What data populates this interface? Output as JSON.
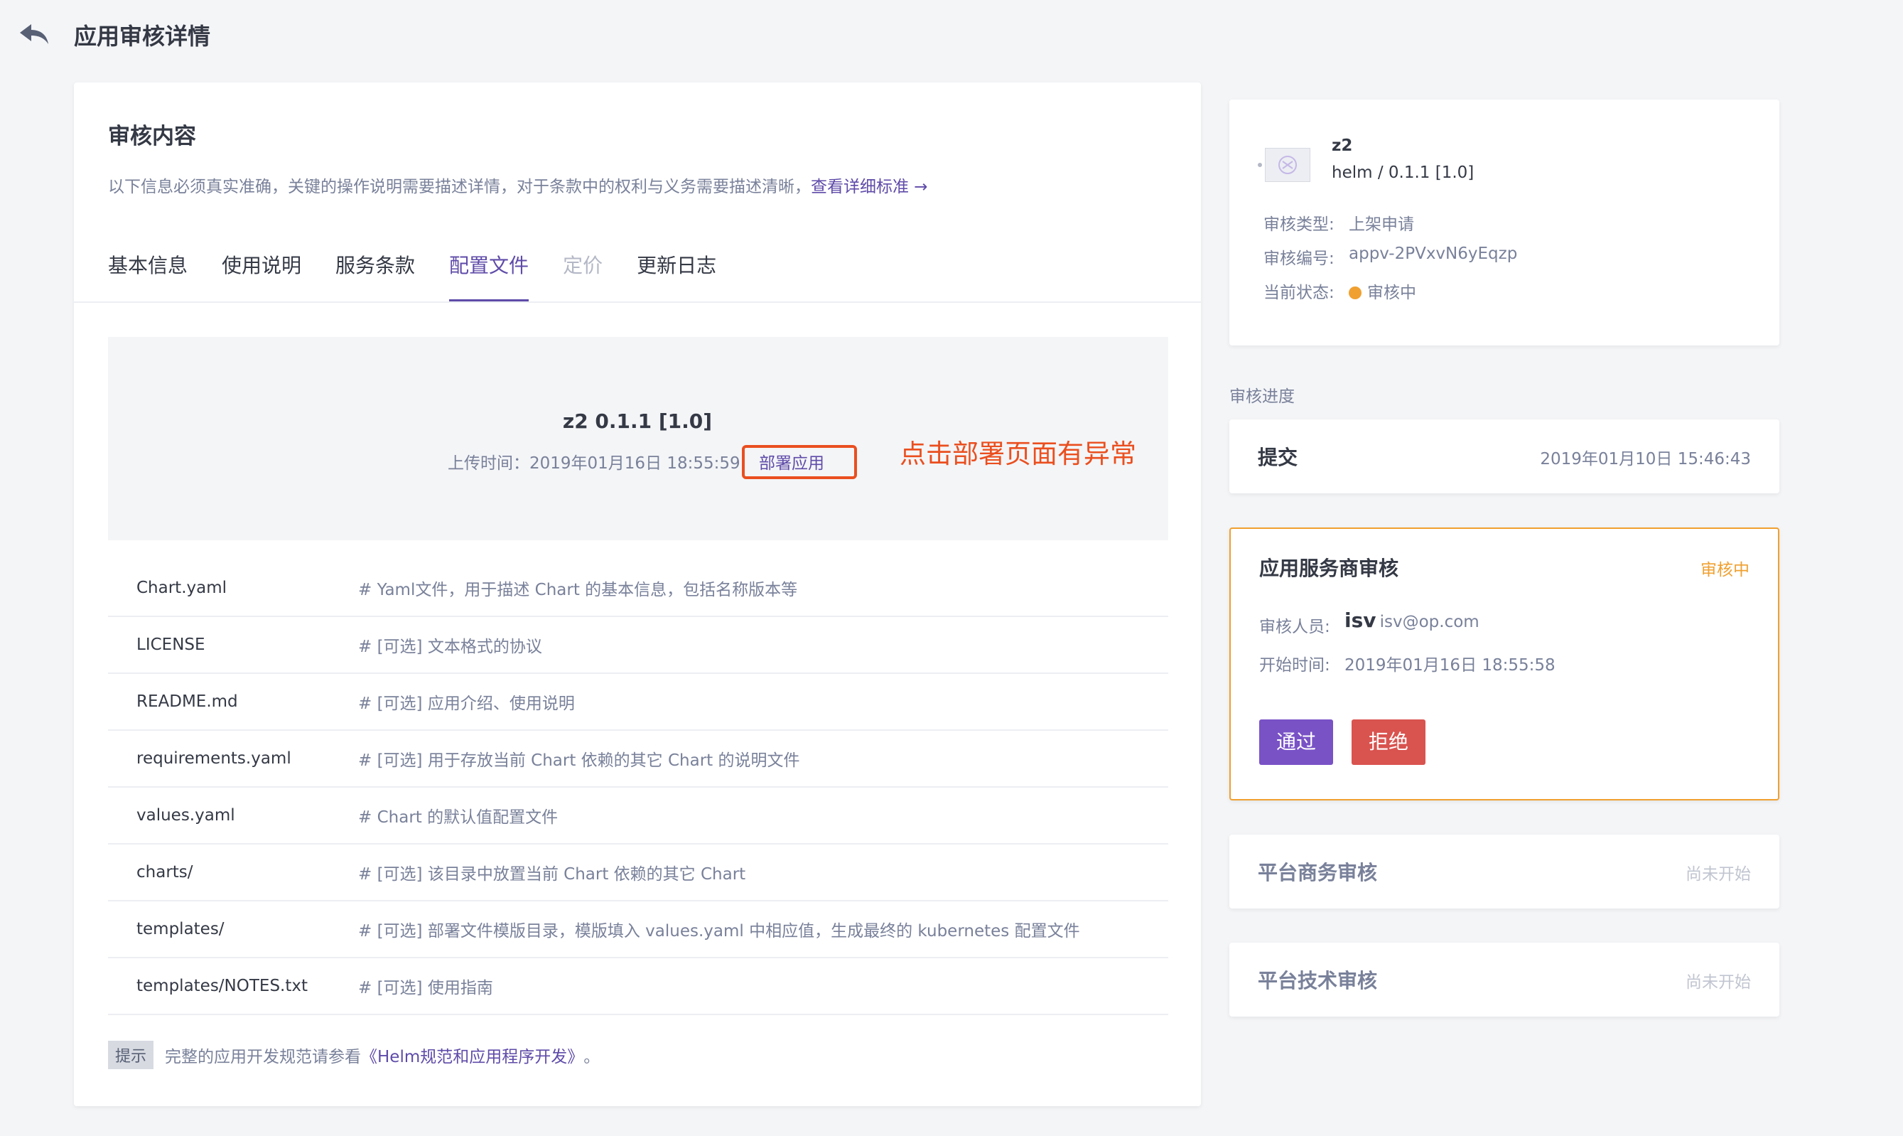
{
  "header": {
    "title": "应用审核详情"
  },
  "main": {
    "title": "审核内容",
    "description": "以下信息必须真实准确，关键的操作说明需要描述详情，对于条款中的权利与义务需要描述清晰，",
    "description_link": "查看详细标准 →",
    "tabs": [
      {
        "label": "基本信息",
        "state": "normal"
      },
      {
        "label": "使用说明",
        "state": "normal"
      },
      {
        "label": "服务条款",
        "state": "normal"
      },
      {
        "label": "配置文件",
        "state": "active"
      },
      {
        "label": "定价",
        "state": "disabled"
      },
      {
        "label": "更新日志",
        "state": "normal"
      }
    ],
    "package": {
      "title": "z2 0.1.1 [1.0]",
      "upload_time": "上传时间：2019年01月16日 18:55:59",
      "deploy_link": "部署应用",
      "annotation": "点击部署页面有异常"
    },
    "files": [
      {
        "name": "Chart.yaml",
        "desc": "# Yaml文件，用于描述 Chart 的基本信息，包括名称版本等"
      },
      {
        "name": "LICENSE",
        "desc": "# [可选] 文本格式的协议"
      },
      {
        "name": "README.md",
        "desc": "# [可选] 应用介绍、使用说明"
      },
      {
        "name": "requirements.yaml",
        "desc": "# [可选] 用于存放当前 Chart 依赖的其它 Chart 的说明文件"
      },
      {
        "name": "values.yaml",
        "desc": "# Chart 的默认值配置文件"
      },
      {
        "name": "charts/",
        "desc": "# [可选] 该目录中放置当前 Chart 依赖的其它 Chart"
      },
      {
        "name": "templates/",
        "desc": "# [可选] 部署文件模版目录，模版填入 values.yaml 中相应值，生成最终的 kubernetes 配置文件"
      },
      {
        "name": "templates/NOTES.txt",
        "desc": "# [可选] 使用指南"
      }
    ],
    "tip": {
      "badge": "提示",
      "text": "完整的应用开发规范请参看",
      "link": "《Helm规范和应用程序开发》",
      "suffix": "。"
    }
  },
  "app_info": {
    "name": "z2",
    "version": "helm / 0.1.1 [1.0]",
    "type_label": "审核类型:",
    "type_value": "上架申请",
    "id_label": "审核编号:",
    "id_value": "appv-2PVxvN6yEqzp",
    "status_label": "当前状态:",
    "status_value": "审核中",
    "status_color": "#f0a030"
  },
  "progress": {
    "title": "审核进度",
    "submit": {
      "name": "提交",
      "time": "2019年01月10日 15:46:43"
    },
    "isv_review": {
      "name": "应用服务商审核",
      "status": "审核中",
      "reviewer_label": "审核人员:",
      "reviewer_name": "isv",
      "reviewer_email": "isv@op.com",
      "start_label": "开始时间:",
      "start_time": "2019年01月16日 18:55:58",
      "pass_button": "通过",
      "reject_button": "拒绝"
    },
    "business_review": {
      "name": "平台商务审核",
      "status": "尚未开始"
    },
    "tech_review": {
      "name": "平台技术审核",
      "status": "尚未开始"
    }
  },
  "colors": {
    "accent": "#5f4ba9",
    "pass": "#7952c6",
    "reject": "#d9534f",
    "warning": "#f0a030",
    "annotation": "#ea4f1f"
  }
}
